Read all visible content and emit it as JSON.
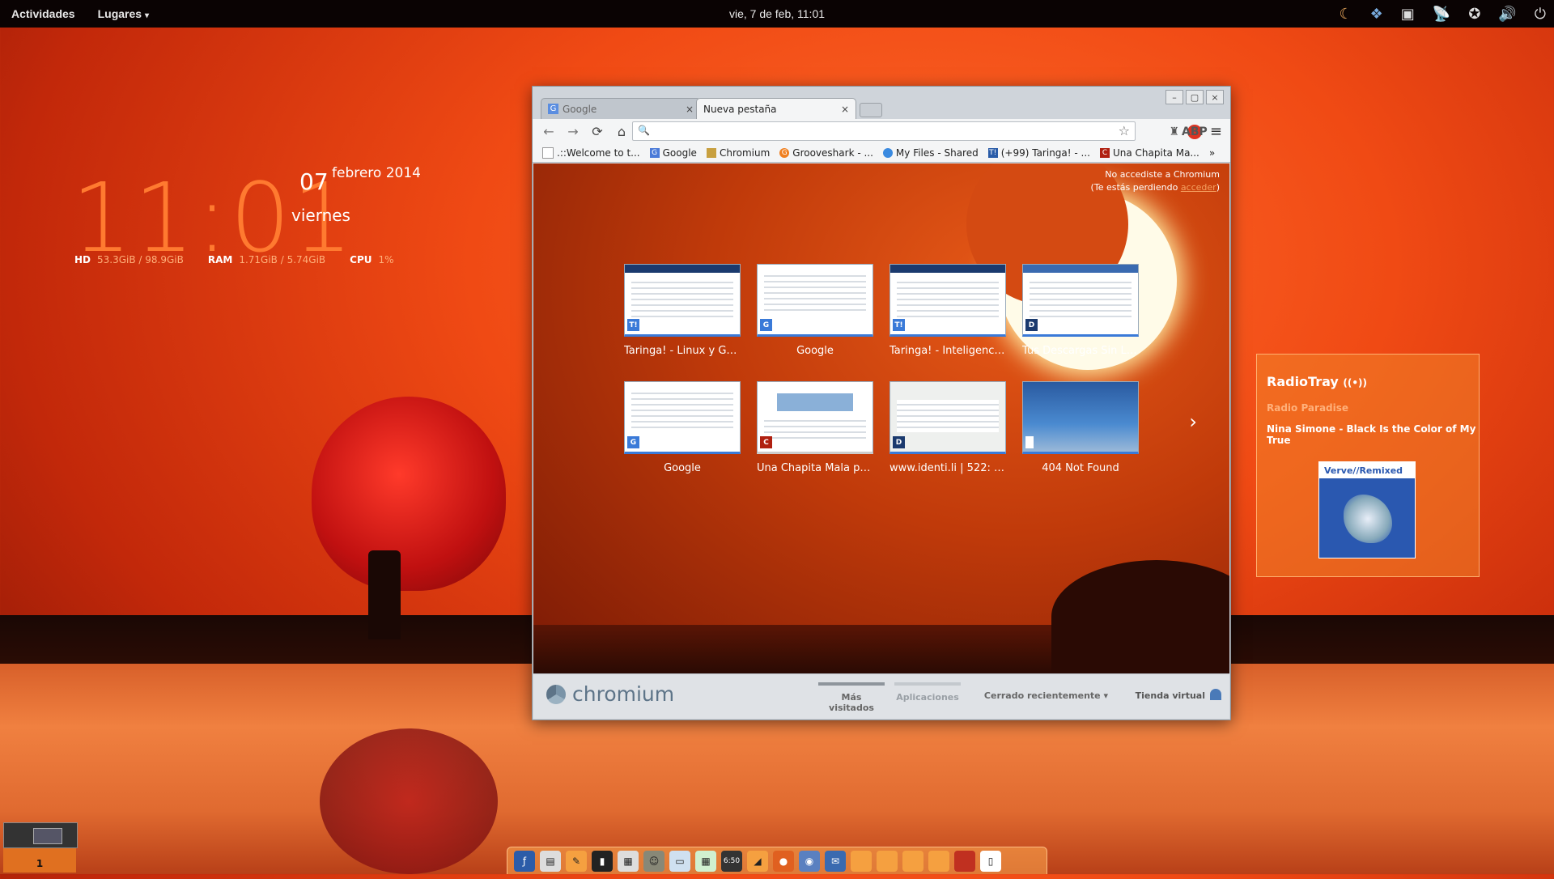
{
  "topbar": {
    "activities": "Actividades",
    "places": "Lugares",
    "places_arrow": "▾",
    "clock": "vie,  7 de feb, 11:01",
    "tray_icons": [
      "weather-icon",
      "dropbox-icon",
      "user-icon",
      "radio-icon",
      "accessibility-icon",
      "volume-icon",
      "power-icon"
    ]
  },
  "desktop_clock": {
    "time": "11:01",
    "day": "07",
    "month_year": "febrero 2014",
    "weekday": "viernes",
    "stats": [
      {
        "label": "HD",
        "value": "53.3GiB / 98.9GiB"
      },
      {
        "label": "RAM",
        "value": "1.71GiB / 5.74GiB"
      },
      {
        "label": "CPU",
        "value": "1%"
      }
    ]
  },
  "browser": {
    "tabs": [
      {
        "label": "Google",
        "icon": "G",
        "active": false
      },
      {
        "label": "Nueva pestaña",
        "active": true
      }
    ],
    "close_glyph": "×",
    "window_controls": [
      "–",
      "▢",
      "×"
    ],
    "nav": {
      "back": "←",
      "forward": "→",
      "reload": "⟳",
      "home": "⌂"
    },
    "omnibox": {
      "value": "",
      "search_glyph": "🔍",
      "star_glyph": "☆"
    },
    "toolbar_right": {
      "extension": "♜",
      "abp": "ABP",
      "menu": "≡"
    },
    "bookmarks": [
      {
        "label": ".::Welcome to t...",
        "icon": "page",
        "color": "#ffffff"
      },
      {
        "label": "Google",
        "icon": "G",
        "color": "#4a7ad8"
      },
      {
        "label": "Chromium",
        "icon": "folder",
        "color": "#c8a040"
      },
      {
        "label": "Grooveshark - ...",
        "icon": "G",
        "color": "#f08020"
      },
      {
        "label": "My Files - Shared",
        "icon": "cloud",
        "color": "#3a8ae0"
      },
      {
        "label": "(+99) Taringa! - ...",
        "icon": "T!",
        "color": "#2a5ca8"
      },
      {
        "label": "Una Chapita Ma...",
        "icon": "C",
        "color": "#b02010"
      }
    ],
    "bookmarks_more": "»",
    "not_signed": {
      "line1": "No accediste a Chromium",
      "line2_prefix": "(Te estás perdiendo ",
      "link": "acceder",
      "line2_suffix": ")"
    },
    "most_visited": [
      {
        "label": "Taringa! - Linux y GNU",
        "badge": "T!"
      },
      {
        "label": "Google",
        "badge": "G"
      },
      {
        "label": "Taringa! - Inteligenci...",
        "badge": "T!"
      },
      {
        "label": "Tus Descargas Sin Li...",
        "badge": "D"
      },
      {
        "label": "Google",
        "badge": "G"
      },
      {
        "label": "Una Chapita Mala pe...",
        "badge": "C"
      },
      {
        "label": "www.identi.li | 522: C...",
        "badge": "D"
      },
      {
        "label": "404 Not Found",
        "badge": ""
      }
    ],
    "next_arrow": "›",
    "bottom": {
      "brand": "chromium",
      "tab_most_visited": "Más visitados",
      "tab_apps": "Aplicaciones",
      "recently_closed": "Cerrado recientemente ▾",
      "store": "Tienda virtual"
    }
  },
  "radiotray": {
    "title": "RadioTray",
    "title_icon": "((•))",
    "station": "Radio Paradise",
    "song": "Nina Simone - Black Is the Color of My True",
    "cover_label": "Verve//Remixed"
  },
  "workspace": {
    "number": "1"
  },
  "dock": {
    "clock_badge": "6:50",
    "apps": [
      "fedora-icon",
      "files-icon",
      "text-editor-icon",
      "terminal-icon",
      "calculator-icon",
      "gimp-icon",
      "writer-icon",
      "calc-icon",
      "clock-icon",
      "impress-icon",
      "firefox-icon",
      "chromium-icon",
      "thunderbird-icon",
      "folder-icon",
      "folder-icon",
      "folder-icon",
      "folder-icon",
      "image-icon",
      "phone-icon"
    ]
  }
}
